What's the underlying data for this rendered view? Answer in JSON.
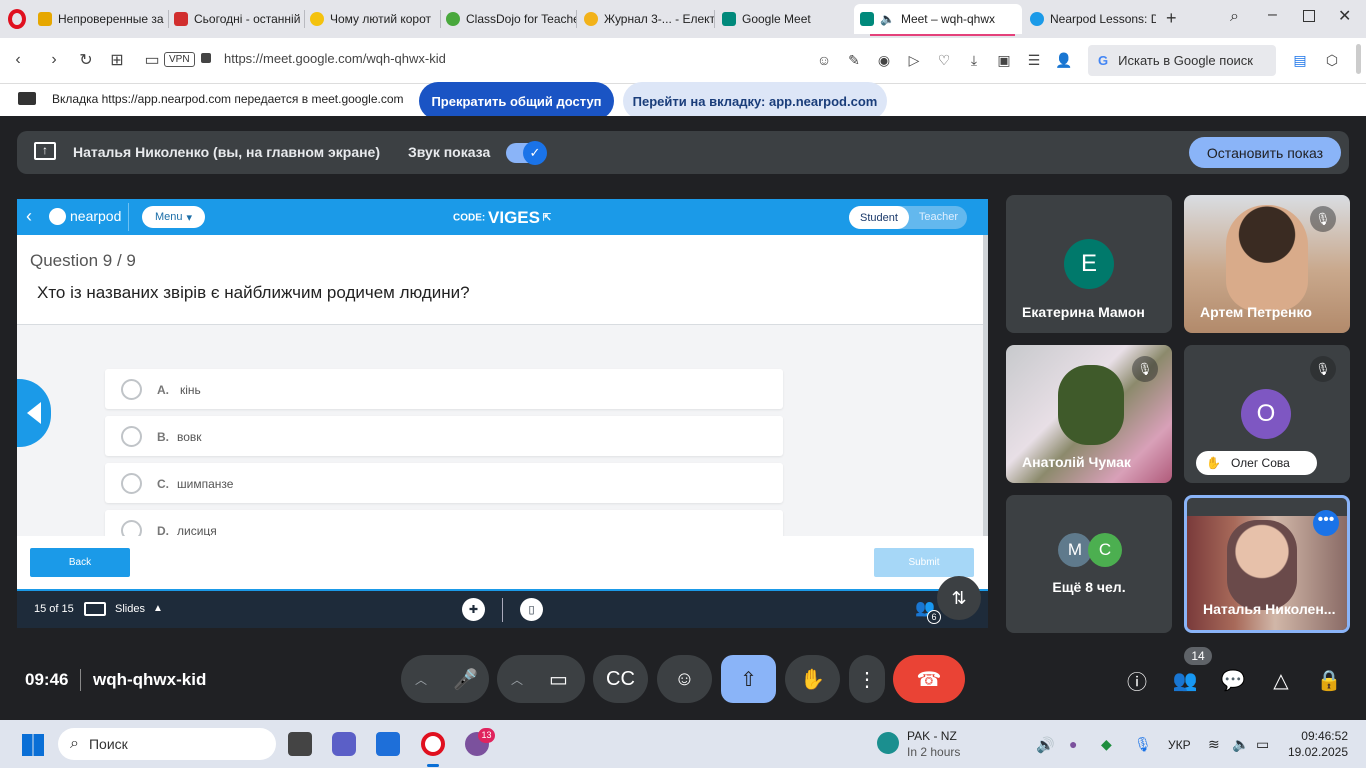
{
  "browser": {
    "tabs": [
      {
        "title": "Непроверенные за",
        "color": "#e6a700"
      },
      {
        "title": "Сьогодні - останній",
        "color": "#d12e2e"
      },
      {
        "title": "Чому лютий корот",
        "color": "#f4c20d"
      },
      {
        "title": "ClassDojo for Teache",
        "color": "#49a83d"
      },
      {
        "title": "Журнал 3-... - Елект",
        "color": "#f2b21a"
      },
      {
        "title": "Google Meet",
        "color": "#00897b"
      },
      {
        "title": "Meet – wqh-qhwx",
        "color": "#00897b"
      },
      {
        "title": "Nearpod Lessons: D",
        "color": "#1b9ae8"
      }
    ],
    "url": "https://meet.google.com/wqh-qhwx-kid",
    "vpn_label": "VPN",
    "search_label": "Искать в Google поиск",
    "share_notice": "Вкладка https://app.nearpod.com передается в meet.google.com",
    "stop_sharing_label": "Прекратить общий доступ",
    "switch_tab_label": "Перейти на вкладку: app.nearpod.com"
  },
  "presentation_bar": {
    "presenter": "Наталья Николенко (вы, на главном экране)",
    "sound_label": "Звук показа",
    "stop_label": "Остановить показ"
  },
  "nearpod": {
    "logo": "nearpod",
    "menu_label": "Menu",
    "code_prefix": "CODE:",
    "code": "VIGES",
    "role_student": "Student",
    "role_teacher": "Teacher",
    "question_number": "Question 9 / 9",
    "question_text": "Хто із названих звірів є найближчим родичем людини?",
    "options": [
      {
        "letter": "A.",
        "text": "кінь"
      },
      {
        "letter": "B.",
        "text": "вовк"
      },
      {
        "letter": "C.",
        "text": "шимпанзе"
      },
      {
        "letter": "D.",
        "text": "лисиця"
      }
    ],
    "back_label": "Back",
    "submit_label": "Submit",
    "slide_counter": "15 of 15",
    "slides_label": "Slides",
    "participants_badge": "6"
  },
  "participants": [
    {
      "name": "Екатерина Мамон",
      "initial": "Е",
      "avatar_color": "#00796b"
    },
    {
      "name": "Артем Петренко"
    },
    {
      "name": "Анатолій Чумак"
    },
    {
      "name": "Олег Сова",
      "initial": "О",
      "avatar_color": "#7e57c2"
    },
    {
      "name": "Ещё 8 чел.",
      "initials": [
        "М",
        "С"
      ]
    },
    {
      "name": "Наталья Николен..."
    }
  ],
  "controls": {
    "time": "09:46",
    "meeting_code": "wqh-qhwx-kid",
    "people_count": "14"
  },
  "taskbar": {
    "search_label": "Поиск",
    "viber_badge": "13",
    "weather_title": "PAK - NZ",
    "weather_sub": "In 2 hours",
    "lang": "УКР",
    "time": "09:46:52",
    "date": "19.02.2025"
  }
}
